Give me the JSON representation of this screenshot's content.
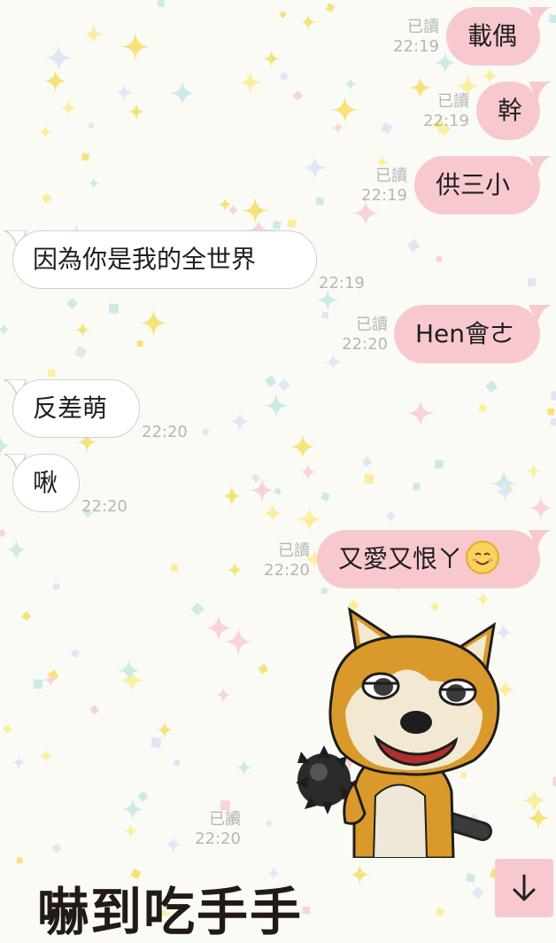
{
  "messages": [
    {
      "side": "sent",
      "text": "載偶",
      "status": "已讀",
      "time": "22:19"
    },
    {
      "side": "sent",
      "text": "幹",
      "status": "已讀",
      "time": "22:19"
    },
    {
      "side": "sent",
      "text": "供三小",
      "status": "已讀",
      "time": "22:19"
    },
    {
      "side": "recv",
      "text": "因為你是我的全世界",
      "time": "22:19"
    },
    {
      "side": "sent",
      "text": "Hen會ㄜ",
      "status": "已讀",
      "time": "22:20"
    },
    {
      "side": "recv",
      "text": "反差萌",
      "time": "22:20"
    },
    {
      "side": "recv",
      "text": "啾",
      "time": "22:20"
    },
    {
      "side": "sent",
      "text": "又愛又恨ㄚ",
      "emoji": "smiling-face-emoji",
      "status": "已讀",
      "time": "22:20"
    }
  ],
  "sticker": {
    "name": "shiba-dog-with-spiked-club",
    "status": "已讀",
    "time": "22:20"
  },
  "bottom_text": "嚇到吃手手",
  "scroll_button": {
    "icon": "arrow-down-icon"
  },
  "colors": {
    "sent_bubble": "#f7c9cf",
    "recv_bubble": "#ffffff",
    "meta": "#b5b5b5"
  }
}
